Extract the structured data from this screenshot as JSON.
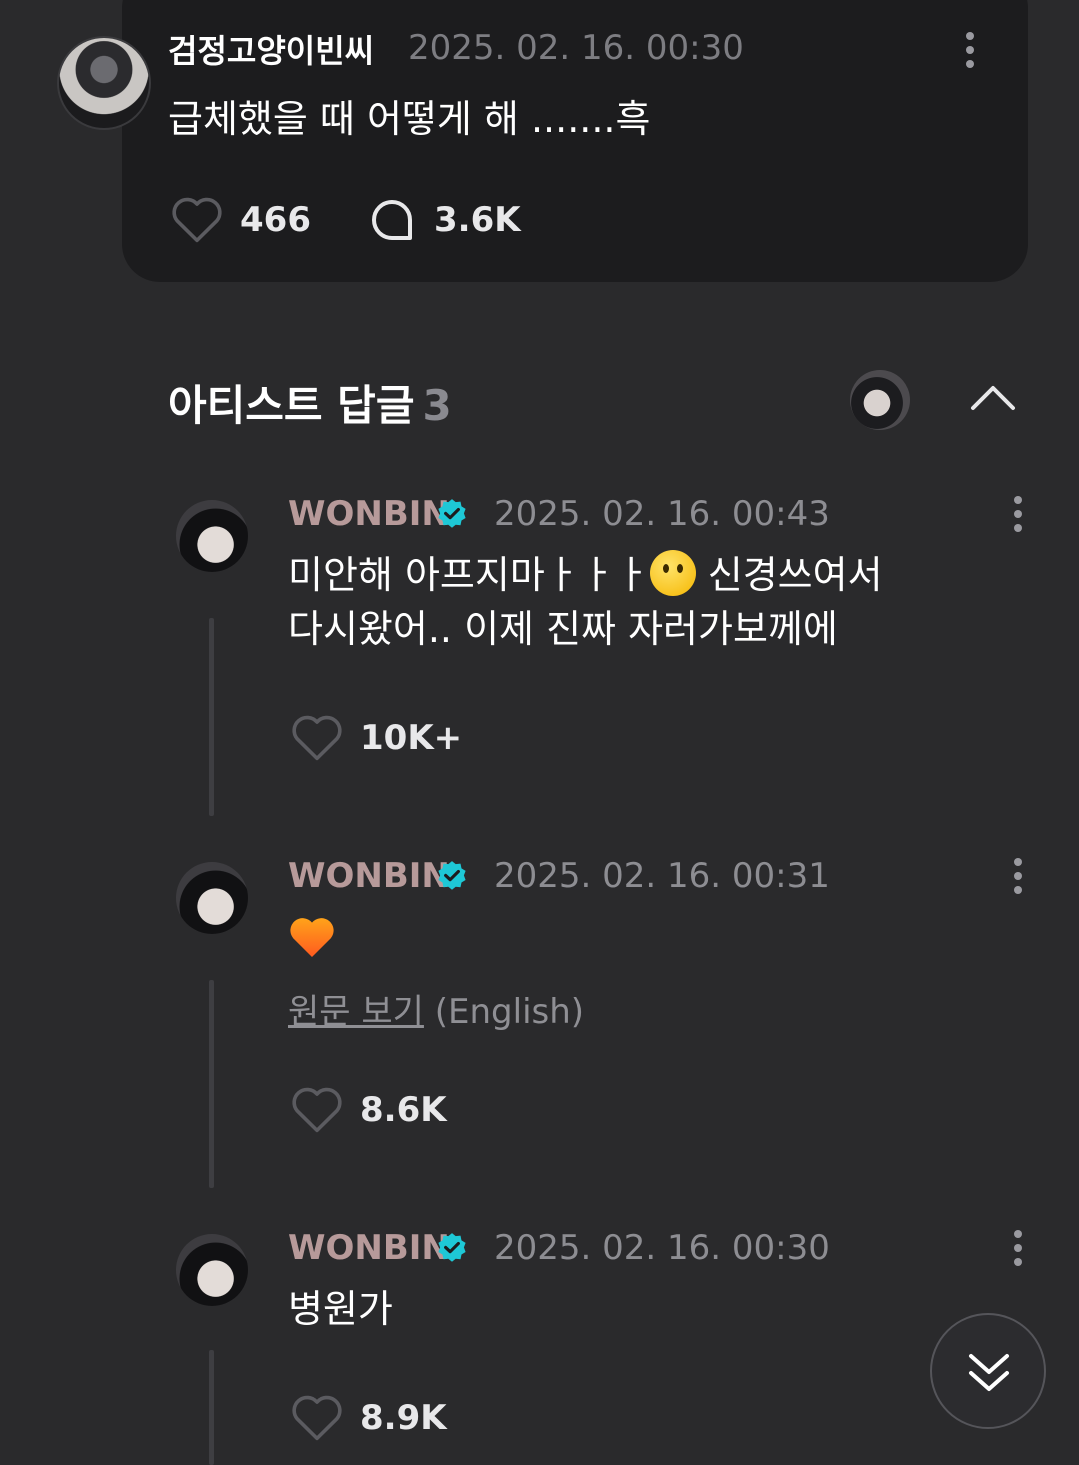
{
  "post": {
    "username": "검정고양이빈씨",
    "timestamp": "2025. 02. 16. 00:30",
    "text": "급체했을 때 어떻게 해 .......흑",
    "like_count": "466",
    "comment_count": "3.6K"
  },
  "artist_replies": {
    "title": "아티스트 답글",
    "count": "3"
  },
  "replies": [
    {
      "name": "WONBIN",
      "timestamp": "2025. 02. 16. 00:43",
      "text_line1_a": "미안해 아프지마ㅏㅏㅏ",
      "text_line1_b": " 신경쓰여서",
      "text_line2": "다시왔어.. 이제 진짜 자러가보께에",
      "like_count": "10K+"
    },
    {
      "name": "WONBIN",
      "timestamp": "2025. 02. 16. 00:31",
      "translate_link": "원문 보기",
      "translate_lang": " (English)",
      "like_count": "8.6K"
    },
    {
      "name": "WONBIN",
      "timestamp": "2025. 02. 16. 00:30",
      "text": "병원가",
      "like_count": "8.9K"
    }
  ],
  "colors": {
    "background": "#2a2a2c",
    "card": "#1c1c1e",
    "artist_name": "#b79a9a",
    "verified": "#1ec8d6"
  }
}
